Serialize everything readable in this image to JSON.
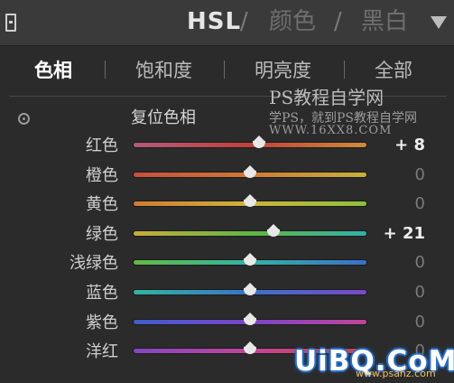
{
  "header": {
    "title_hsl": "HSL",
    "sep1": "/",
    "title_color": "颜色",
    "sep2": "/",
    "title_bw": "黑白"
  },
  "tabs": [
    {
      "label": "色相",
      "active": true
    },
    {
      "label": "饱和度",
      "active": false
    },
    {
      "label": "明亮度",
      "active": false
    },
    {
      "label": "全部",
      "active": false
    }
  ],
  "reset_label": "复位色相",
  "watermark": {
    "line1": "PS教程自学网",
    "line2": "学PS，就到PS教程自学网",
    "line3": "WWW.16XX8.COM"
  },
  "sliders": [
    {
      "label": "红色",
      "value": "+ 8",
      "fraction": 0.54,
      "gradient": [
        "#b25a7a",
        "#c2413a",
        "#d08a3a"
      ]
    },
    {
      "label": "橙色",
      "value": "0",
      "fraction": 0.5,
      "gradient": [
        "#c84e3d",
        "#d07a35",
        "#c7b23a"
      ]
    },
    {
      "label": "黄色",
      "value": "0",
      "fraction": 0.5,
      "gradient": [
        "#d27a34",
        "#cbb43a",
        "#8fbf3b"
      ]
    },
    {
      "label": "绿色",
      "value": "+ 21",
      "fraction": 0.6,
      "gradient": [
        "#c7ad3a",
        "#62b545",
        "#32b0a8"
      ]
    },
    {
      "label": "浅绿色",
      "value": "0",
      "fraction": 0.5,
      "gradient": [
        "#63b843",
        "#33b4a4",
        "#3a6fc8"
      ]
    },
    {
      "label": "蓝色",
      "value": "0",
      "fraction": 0.5,
      "gradient": [
        "#32b5a0",
        "#3a72c7",
        "#7a48c4"
      ]
    },
    {
      "label": "紫色",
      "value": "0",
      "fraction": 0.5,
      "gradient": [
        "#3f5ec9",
        "#7a44c6",
        "#c1449a"
      ]
    },
    {
      "label": "洋红",
      "value": "0",
      "fraction": 0.5,
      "gradient": [
        "#8446c2",
        "#c2449a",
        "#c84545"
      ]
    }
  ],
  "logo": {
    "text": "UiBQ.CoM",
    "sub": "www.psahz.com"
  }
}
